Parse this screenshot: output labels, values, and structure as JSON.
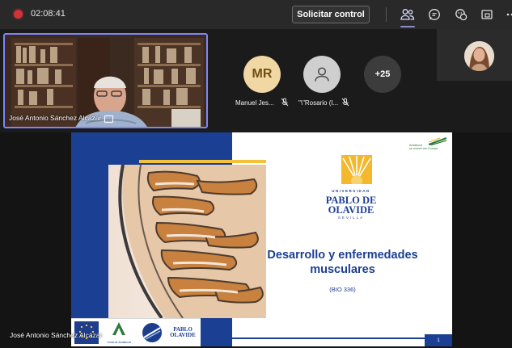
{
  "meeting": {
    "elapsed_time": "02:08:41",
    "request_control_label": "Solicitar control"
  },
  "toolbar_icons": [
    "people-icon",
    "chat-icon",
    "reactions-icon",
    "share-icon",
    "more-icon"
  ],
  "active_speaker": {
    "name": "José Antonio Sánchez Alcázar"
  },
  "participants": [
    {
      "initials": "MR",
      "name": "Manuel Jes...",
      "mic": "muted"
    },
    {
      "initials": "",
      "name": "\"\\\"Rosario (I...",
      "mic": "muted"
    }
  ],
  "more_participants": "+25",
  "presenter": {
    "name": "José Antonio Sánchez Alcázar"
  },
  "slide": {
    "university_label": "UNIVERSIDAD",
    "university_name_line1": "PABLO DE",
    "university_name_line2": "OLAVIDE",
    "university_city": "SEVILLA",
    "title_line1": "Desarrollo y enfermedades",
    "title_line2": "musculares",
    "course_code": "(BIO 336)",
    "page_number": "1",
    "regional_logo_line1": "Andalucía",
    "regional_logo_line2": "se mueve con Europa",
    "footer_logo_junta_line1": "Junta de Andalucía",
    "footer_logo_upo_line1": "PABLO",
    "footer_logo_upo_line2": "OLAVIDE"
  },
  "colors": {
    "slide_blue": "#1b3f92",
    "accent_yellow": "#f3c13a",
    "speaker_border": "#7f85f5",
    "record_red": "#d13438"
  }
}
